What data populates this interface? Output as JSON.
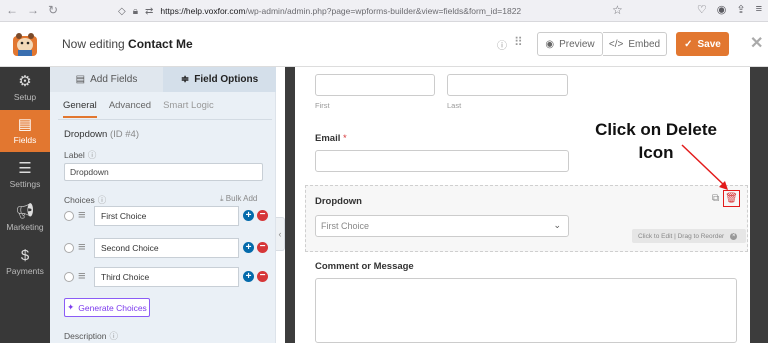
{
  "browser": {
    "url_host": "https://help.voxfor.com",
    "url_path": "/wp-admin/admin.php?page=wpforms-builder&view=fields&form_id=1822"
  },
  "header": {
    "editing_prefix": "Now editing",
    "form_name": "Contact Me",
    "preview_label": "Preview",
    "embed_label": "Embed",
    "save_label": "Save"
  },
  "sidebar": {
    "items": [
      {
        "label": "Setup",
        "icon": "gear-icon"
      },
      {
        "label": "Fields",
        "icon": "fields-icon"
      },
      {
        "label": "Settings",
        "icon": "sliders-icon"
      },
      {
        "label": "Marketing",
        "icon": "megaphone-icon"
      },
      {
        "label": "Payments",
        "icon": "dollar-icon"
      }
    ]
  },
  "panel": {
    "tabs": [
      "Add Fields",
      "Field Options"
    ],
    "subtabs": [
      "General",
      "Advanced",
      "Smart Logic"
    ],
    "field_name": "Dropdown",
    "field_id": "(ID #4)",
    "label_caption": "Label",
    "label_value": "Dropdown",
    "choices_caption": "Choices",
    "bulk_add": "Bulk Add",
    "choices": [
      "First Choice",
      "Second Choice",
      "Third Choice"
    ],
    "generate_label": "Generate Choices",
    "description_caption": "Description"
  },
  "preview": {
    "first_sublabel": "First",
    "last_sublabel": "Last",
    "email_label": "Email",
    "required_mark": "*",
    "dropdown_label": "Dropdown",
    "dropdown_value": "First Choice",
    "reorder_hint": "Click to Edit | Drag to Reorder",
    "comment_label": "Comment or Message",
    "callout_text": "Click on Delete Icon"
  },
  "colors": {
    "accent": "#e27730",
    "sidebar_bg": "#383838",
    "delete_red": "#d63638",
    "callout_box": "#e31b1b"
  }
}
